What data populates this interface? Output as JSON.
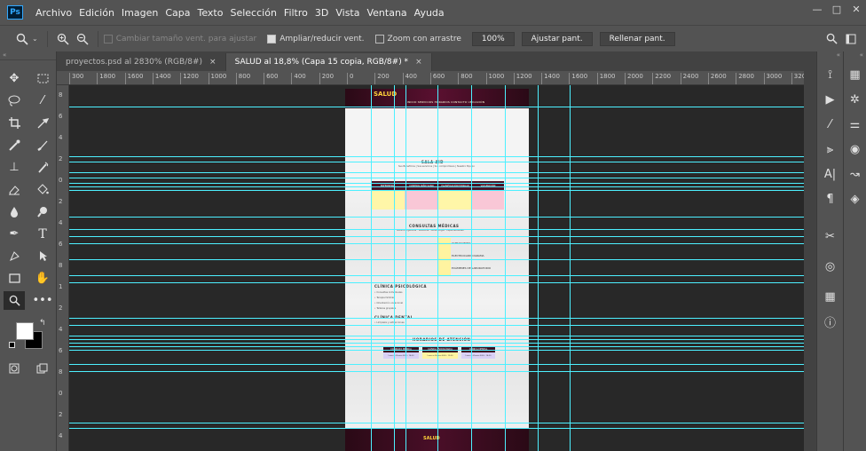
{
  "app": {
    "logo": "Ps"
  },
  "menu": [
    "Archivo",
    "Edición",
    "Imagen",
    "Capa",
    "Texto",
    "Selección",
    "Filtro",
    "3D",
    "Vista",
    "Ventana",
    "Ayuda"
  ],
  "window_controls": {
    "minimize": "—",
    "maximize": "□",
    "close": "✕"
  },
  "options": {
    "resize_windows": "Cambiar tamaño vent. para ajustar",
    "zoom_all": "Ampliar/reducir vent.",
    "scrubby_zoom": "Zoom con arrastre",
    "zoom_value": "100%",
    "fit_screen": "Ajustar pant.",
    "fill_screen": "Rellenar pant."
  },
  "toolbar_collapse": "«",
  "right_collapse": "«",
  "tabs": [
    {
      "label": "proyectos.psd al 2830% (RGB/8#)",
      "close": "×",
      "active": false
    },
    {
      "label": "SALUD al 18,8% (Capa 15 copia, RGB/8#) *",
      "close": "×",
      "active": true
    }
  ],
  "ruler_h": [
    "300",
    "1800",
    "1600",
    "1400",
    "1200",
    "1000",
    "800",
    "600",
    "400",
    "200",
    "0",
    "200",
    "400",
    "600",
    "800",
    "1000",
    "1200",
    "1400",
    "1600",
    "1800",
    "2000",
    "2200",
    "2400",
    "2600",
    "2800",
    "3000",
    "3200"
  ],
  "ruler_v": [
    "8",
    "6",
    "4",
    "2",
    "0",
    "2",
    "4",
    "6",
    "8",
    "1",
    "2",
    "4",
    "6",
    "8",
    "0",
    "2",
    "4"
  ],
  "icons": {
    "zoom": "zoom-icon",
    "zoom_in": "zoom-in-icon",
    "zoom_out": "zoom-out-icon",
    "search": "search-icon",
    "workspace": "workspace-icon"
  },
  "doc": {
    "logo": "SALUD",
    "nav": "INICIO   SERVICIOS   HORARIOS   CONTACTO   UBICACIÓN",
    "section1_title": "SALA AID",
    "section1_sub": "Sus Beneficios | Sus servicios | Sus compromisos | Nuestro Equipo",
    "services": [
      "ENFERMERÍA",
      "CONTROL NIÑO SANO",
      "PLANIFICACIÓN FAMILIAR",
      "VACUNACIÓN"
    ],
    "section2_title": "CONSULTAS MÉDICAS",
    "section2_sub": "Medicina general · Pediatría · Ginecología · Especialidades",
    "consult_items": [
      "ULTRASONIDO",
      "ELECTROCARDIOGRAMA",
      "EXÁMENES DE LABORATORIO"
    ],
    "section3_title": "CLÍNICA PSICOLÓGICA",
    "section3_lines": [
      "• Consultas individuales",
      "• Terapia familiar",
      "• Orientación vocacional",
      "• Talleres grupales"
    ],
    "section4_title": "CLÍNICA DENTAL",
    "section4_lines": [
      "• Limpieza y extracciones"
    ],
    "section5_title": "HORARIOS DE ATENCIÓN",
    "hours_heads": [
      "CONSULTA MÉDICA",
      "CLÍNICA PSICOLÓGICA",
      "CLÍNICA DENTAL"
    ],
    "hours_bodies": [
      "Lunes a Viernes 8:00 - 16:00",
      "Lunes a Viernes 8:00 - 12:00",
      "Lunes a Viernes 8:00 - 16:00"
    ],
    "footer_logo": "SALUD"
  }
}
